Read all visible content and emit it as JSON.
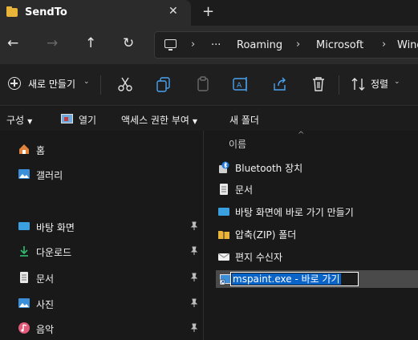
{
  "tab": {
    "title": "SendTo",
    "close": "✕",
    "new_tab": "+"
  },
  "nav": {
    "back": "←",
    "forward": "→",
    "up": "↑",
    "refresh": "↻",
    "breadcrumb": {
      "overflow": "···",
      "sep": "›",
      "parts": [
        "Roaming",
        "Microsoft",
        "Wind"
      ]
    }
  },
  "command_bar": {
    "new_label": "새로 만들기",
    "new_chevron": "⌄",
    "sort_label": "정렬",
    "sort_chevron": "⌄"
  },
  "menu_bar": {
    "items": [
      "구성",
      "열기",
      "액세스 권한 부여",
      "새 폴더"
    ],
    "dropdown_arrow": "▼"
  },
  "sidebar": {
    "top_items": [
      {
        "label": "홈",
        "icon": "home-icon"
      },
      {
        "label": "갤러리",
        "icon": "gallery-icon"
      }
    ],
    "pinned_items": [
      {
        "label": "바탕 화면",
        "icon": "desktop-icon"
      },
      {
        "label": "다운로드",
        "icon": "download-icon"
      },
      {
        "label": "문서",
        "icon": "document-icon"
      },
      {
        "label": "사진",
        "icon": "pictures-icon"
      },
      {
        "label": "음악",
        "icon": "music-icon"
      }
    ]
  },
  "main": {
    "column_header": "이름",
    "sort_caret": "^",
    "files": [
      {
        "label": "Bluetooth 장치",
        "icon": "bluetooth-icon"
      },
      {
        "label": "문서",
        "icon": "document-icon"
      },
      {
        "label": "바탕 화면에 바로 가기 만들기",
        "icon": "desktop-shortcut-icon"
      },
      {
        "label": "압축(ZIP) 폴더",
        "icon": "zip-folder-icon"
      },
      {
        "label": "편지 수신자",
        "icon": "mail-recipient-icon"
      }
    ],
    "renaming": {
      "value": "mspaint.exe - 바로 가기",
      "icon": "shortcut-icon"
    }
  },
  "colors": {
    "accent": "#0a64c8",
    "folder": "#e8b43a",
    "selection": "#4a4a4a"
  }
}
